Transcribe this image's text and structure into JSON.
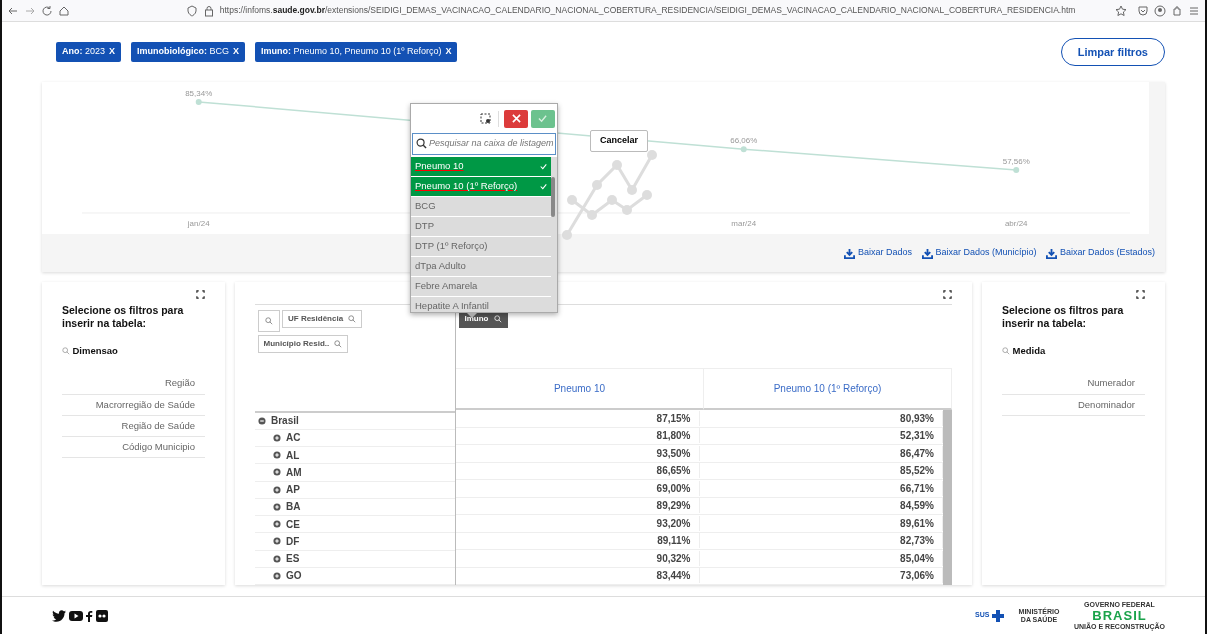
{
  "browser": {
    "url": "https://infoms.**saude.gov.br**/extensions/SEIDIGI_DEMAS_VACINACAO_CALENDARIO_NACIONAL_COBERTURA_RESIDENCIA/SEIDIGI_DEMAS_VACINACAO_CALENDARIO_NACIONAL_COBERTURA_RESIDENCIA.htm"
  },
  "filters": [
    {
      "text": "**Ano:** 2023",
      "remove": "X"
    },
    {
      "text": "**Imunobiológico:** BCG",
      "remove": "X"
    },
    {
      "text": "**Imuno:** Pneumo 10, Pneumo 10 (1º Reforço)",
      "remove": "X"
    }
  ],
  "clear_button": "Limpar filtros",
  "chart": {
    "chart_data": {
      "type": "line",
      "categories": [
        "jan/24",
        null,
        "mar/24",
        "abr/24"
      ],
      "series": [
        {
          "color": "#bfe0d5",
          "marker": "circle",
          "values": [
            85.34,
            null,
            66.06,
            57.56
          ],
          "value_labels": [
            "85,34%",
            null,
            "66,06%",
            "57,56%"
          ]
        }
      ]
    }
  },
  "cancel_button": "Cancelar",
  "downloads": [
    "Baixar Dados",
    "Baixar Dados (Município)",
    "Baixar Dados (Estados)"
  ],
  "listbox": {
    "placeholder": "Pesquisar na caixa de listagem",
    "items": [
      {
        "label": "Pneumo 10",
        "selected": true
      },
      {
        "label": "Pneumo 10 (1º Reforço)",
        "selected": true
      },
      {
        "label": "BCG",
        "selected": false
      },
      {
        "label": "DTP",
        "selected": false
      },
      {
        "label": "DTP (1º Reforço)",
        "selected": false
      },
      {
        "label": "dTpa Adulto",
        "selected": false
      },
      {
        "label": "Febre Amarela",
        "selected": false
      },
      {
        "label": "Hepatite A Infantil",
        "selected": false
      }
    ]
  },
  "left_panel": {
    "title": "Selecione os filtros para inserir na tabela:",
    "search_label": "Dimensao",
    "items": [
      "Região",
      "Macrorregião de Saúde",
      "Região de Saúde",
      "Código Municipio"
    ]
  },
  "pivot": {
    "row_dimensions": [
      "UF Residência",
      "Município Resid.."
    ],
    "column_dimension": "Imuno",
    "columns": [
      "Pneumo 10",
      "Pneumo 10 (1º Reforço)"
    ],
    "rows": [
      {
        "label": "Brasil",
        "expanded": true,
        "values": [
          "87,15%",
          "80,93%"
        ]
      },
      {
        "label": "AC",
        "expanded": false,
        "values": [
          "81,80%",
          "52,31%"
        ]
      },
      {
        "label": "AL",
        "expanded": false,
        "values": [
          "93,50%",
          "86,47%"
        ]
      },
      {
        "label": "AM",
        "expanded": false,
        "values": [
          "86,65%",
          "85,52%"
        ]
      },
      {
        "label": "AP",
        "expanded": false,
        "values": [
          "69,00%",
          "66,71%"
        ]
      },
      {
        "label": "BA",
        "expanded": false,
        "values": [
          "89,29%",
          "84,59%"
        ]
      },
      {
        "label": "CE",
        "expanded": false,
        "values": [
          "93,20%",
          "89,61%"
        ]
      },
      {
        "label": "DF",
        "expanded": false,
        "values": [
          "89,11%",
          "82,73%"
        ]
      },
      {
        "label": "ES",
        "expanded": false,
        "values": [
          "90,32%",
          "85,04%"
        ]
      },
      {
        "label": "GO",
        "expanded": false,
        "values": [
          "83,44%",
          "73,06%"
        ]
      }
    ]
  },
  "right_panel": {
    "title": "Selecione os filtros para inserir na tabela:",
    "search_label": "Medida",
    "items": [
      "Numerador",
      "Denominador"
    ]
  },
  "footer": {
    "sus": "SUS",
    "ministry": "MINISTÉRIO DA SAÚDE",
    "gov": "GOVERNO FEDERAL",
    "brasil": "BRASIL",
    "slogan": "UNIÃO E RECONSTRUÇÃO"
  }
}
